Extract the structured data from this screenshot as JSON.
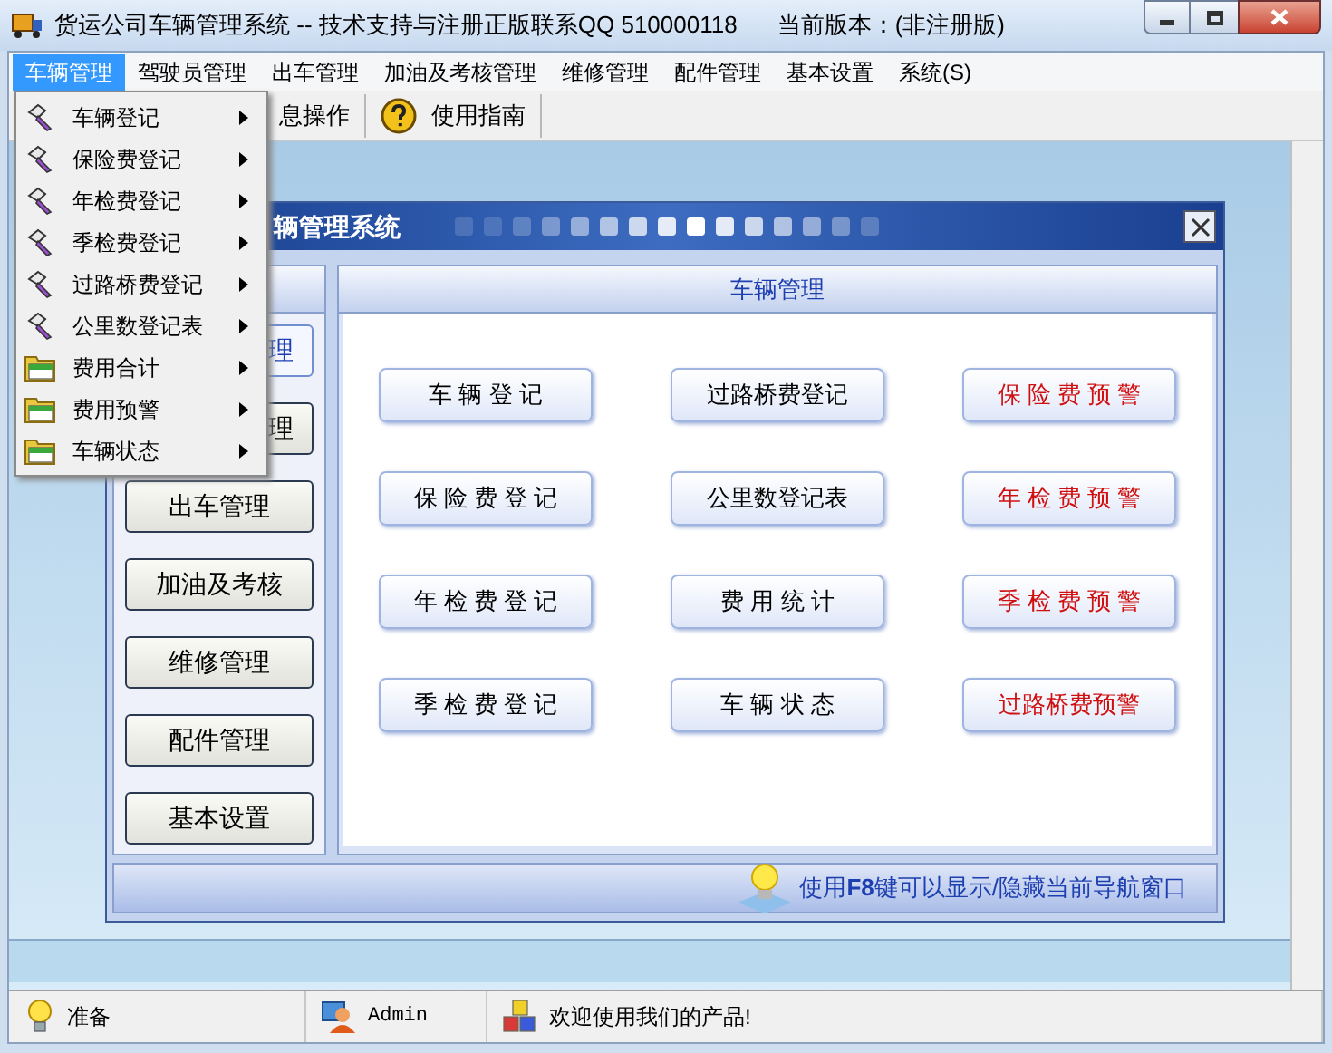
{
  "window": {
    "title": "货运公司车辆管理系统 -- 技术支持与注册正版联系QQ 510000118",
    "version": "当前版本：(非注册版)"
  },
  "menu": [
    {
      "label": "车辆管理",
      "selected": true
    },
    {
      "label": "驾驶员管理",
      "selected": false
    },
    {
      "label": "出车管理",
      "selected": false
    },
    {
      "label": "加油及考核管理",
      "selected": false
    },
    {
      "label": "维修管理",
      "selected": false
    },
    {
      "label": "配件管理",
      "selected": false
    },
    {
      "label": "基本设置",
      "selected": false
    },
    {
      "label": "系统(S)",
      "selected": false
    }
  ],
  "dropdown": [
    {
      "label": "车辆登记",
      "kind": "key"
    },
    {
      "label": "保险费登记",
      "kind": "key"
    },
    {
      "label": "年检费登记",
      "kind": "key"
    },
    {
      "label": "季检费登记",
      "kind": "key"
    },
    {
      "label": "过路桥费登记",
      "kind": "key"
    },
    {
      "label": "公里数登记表",
      "kind": "key"
    },
    {
      "label": "费用合计",
      "kind": "folder"
    },
    {
      "label": "费用预警",
      "kind": "folder"
    },
    {
      "label": "车辆状态",
      "kind": "folder"
    }
  ],
  "toolbar": [
    {
      "label": "息操作",
      "kind": "plain"
    },
    {
      "label": "使用指南",
      "kind": "help"
    }
  ],
  "child_window": {
    "title": "辆管理系统",
    "nav": [
      {
        "label": "理",
        "selected": true
      },
      {
        "label": "理",
        "selected": false
      },
      {
        "label": "出车管理",
        "selected": false
      },
      {
        "label": "加油及考核",
        "selected": false
      },
      {
        "label": "维修管理",
        "selected": false
      },
      {
        "label": "配件管理",
        "selected": false
      },
      {
        "label": "基本设置",
        "selected": false
      }
    ],
    "panel": {
      "title": "车辆管理",
      "buttons": [
        {
          "label": "车 辆 登 记",
          "kind": "normal"
        },
        {
          "label": "过路桥费登记",
          "kind": "normal"
        },
        {
          "label": "保 险 费 预 警",
          "kind": "warning"
        },
        {
          "label": "保 险 费 登 记",
          "kind": "normal"
        },
        {
          "label": "公里数登记表",
          "kind": "normal"
        },
        {
          "label": "年 检 费 预 警",
          "kind": "warning"
        },
        {
          "label": "年 检 费 登 记",
          "kind": "normal"
        },
        {
          "label": "费 用 统 计",
          "kind": "normal"
        },
        {
          "label": "季 检 费 预 警",
          "kind": "warning"
        },
        {
          "label": "季 检 费 登 记",
          "kind": "normal"
        },
        {
          "label": "车 辆 状 态",
          "kind": "normal"
        },
        {
          "label": "过路桥费预警",
          "kind": "warning"
        }
      ]
    },
    "tip": "使用**F8**键可以显示/隐藏当前导航窗口"
  },
  "status_bar": [
    {
      "text": "准备",
      "kind": "bulb"
    },
    {
      "text": "Admin",
      "kind": "user"
    },
    {
      "text": "欢迎使用我们的产品!",
      "kind": "blocks"
    }
  ]
}
